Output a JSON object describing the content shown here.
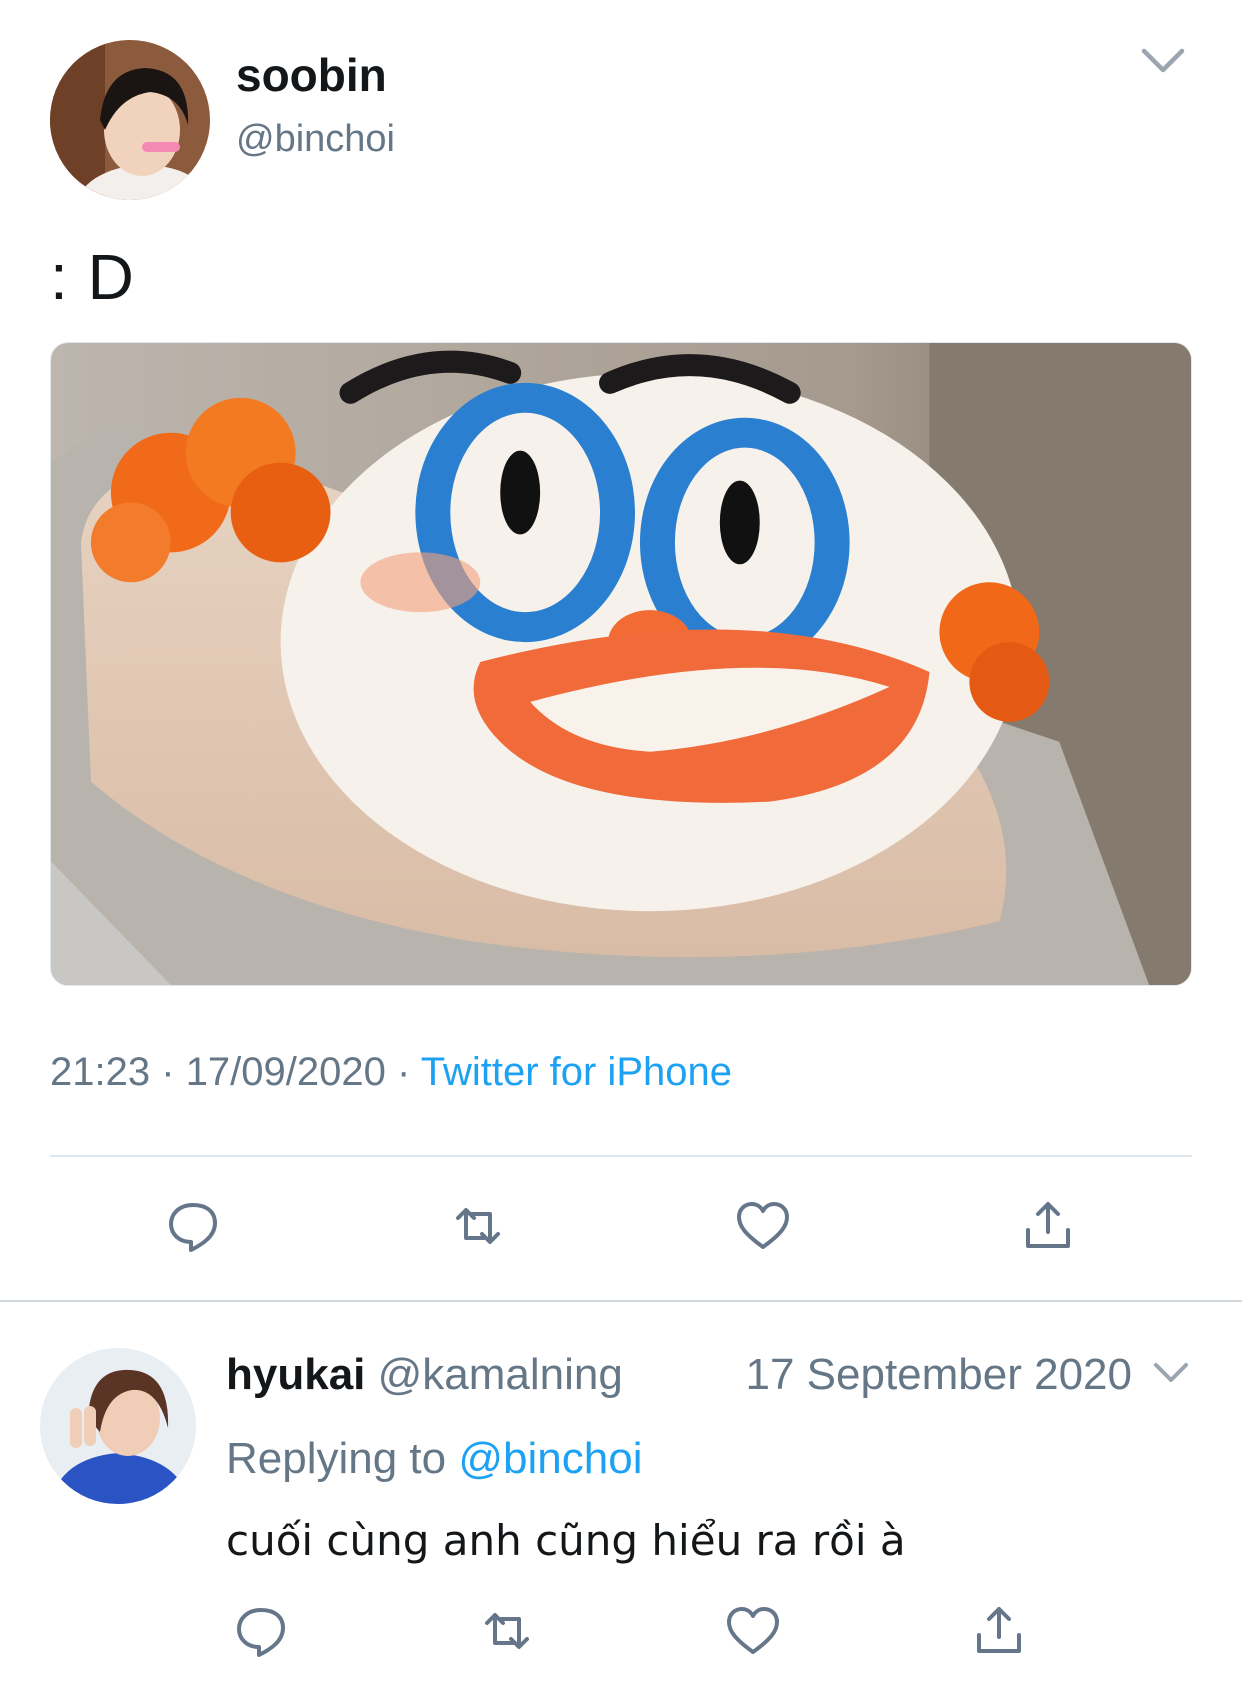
{
  "tweet": {
    "author_name": "soobin",
    "author_handle": "@binchoi",
    "text": ": D",
    "time": "21:23",
    "separator": "·",
    "date": "17/09/2020",
    "source": "Twitter for iPhone"
  },
  "reply": {
    "author_name": "hyukai",
    "author_handle": "@kamalning",
    "date": "17 September 2020",
    "replying_to_label": "Replying to",
    "replying_to_handle": "@binchoi",
    "text": "cuối cùng anh cũng hiểu ra rồi à"
  },
  "icons": {
    "reply": "speech-bubble-icon",
    "retweet": "retweet-icon",
    "like": "heart-icon",
    "share": "share-icon",
    "more": "chevron-down-icon"
  },
  "colors": {
    "link": "#1da1f2",
    "secondary_text": "#657786",
    "primary_text": "#14171a",
    "divider": "#e1e8ed"
  }
}
